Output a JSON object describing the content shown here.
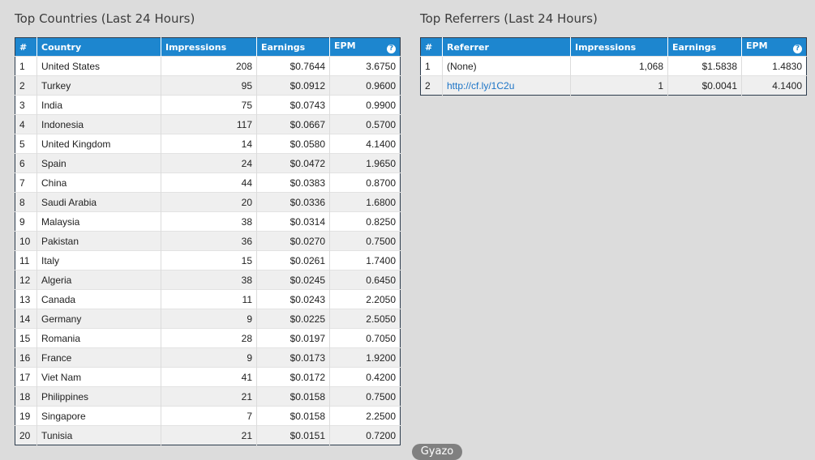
{
  "countries": {
    "title": "Top Countries (Last 24 Hours)",
    "headers": [
      "#",
      "Country",
      "Impressions",
      "Earnings",
      "EPM"
    ],
    "help_icon": "?",
    "rows": [
      [
        "1",
        "United States",
        "208",
        "$0.7644",
        "3.6750"
      ],
      [
        "2",
        "Turkey",
        "95",
        "$0.0912",
        "0.9600"
      ],
      [
        "3",
        "India",
        "75",
        "$0.0743",
        "0.9900"
      ],
      [
        "4",
        "Indonesia",
        "117",
        "$0.0667",
        "0.5700"
      ],
      [
        "5",
        "United Kingdom",
        "14",
        "$0.0580",
        "4.1400"
      ],
      [
        "6",
        "Spain",
        "24",
        "$0.0472",
        "1.9650"
      ],
      [
        "7",
        "China",
        "44",
        "$0.0383",
        "0.8700"
      ],
      [
        "8",
        "Saudi Arabia",
        "20",
        "$0.0336",
        "1.6800"
      ],
      [
        "9",
        "Malaysia",
        "38",
        "$0.0314",
        "0.8250"
      ],
      [
        "10",
        "Pakistan",
        "36",
        "$0.0270",
        "0.7500"
      ],
      [
        "11",
        "Italy",
        "15",
        "$0.0261",
        "1.7400"
      ],
      [
        "12",
        "Algeria",
        "38",
        "$0.0245",
        "0.6450"
      ],
      [
        "13",
        "Canada",
        "11",
        "$0.0243",
        "2.2050"
      ],
      [
        "14",
        "Germany",
        "9",
        "$0.0225",
        "2.5050"
      ],
      [
        "15",
        "Romania",
        "28",
        "$0.0197",
        "0.7050"
      ],
      [
        "16",
        "France",
        "9",
        "$0.0173",
        "1.9200"
      ],
      [
        "17",
        "Viet Nam",
        "41",
        "$0.0172",
        "0.4200"
      ],
      [
        "18",
        "Philippines",
        "21",
        "$0.0158",
        "0.7500"
      ],
      [
        "19",
        "Singapore",
        "7",
        "$0.0158",
        "2.2500"
      ],
      [
        "20",
        "Tunisia",
        "21",
        "$0.0151",
        "0.7200"
      ]
    ]
  },
  "referrers": {
    "title": "Top Referrers (Last 24 Hours)",
    "headers": [
      "#",
      "Referrer",
      "Impressions",
      "Earnings",
      "EPM"
    ],
    "help_icon": "?",
    "rows": [
      [
        "1",
        "(None)",
        "1,068",
        "$1.5838",
        "1.4830"
      ],
      [
        "2",
        "http://cf.ly/1C2u",
        "1",
        "$0.0041",
        "4.1400"
      ]
    ]
  },
  "badge": "Gyazo",
  "colors": {
    "header_bg": "#1d86cf",
    "link": "#1a73c6",
    "page_bg": "#dcdcdc"
  }
}
